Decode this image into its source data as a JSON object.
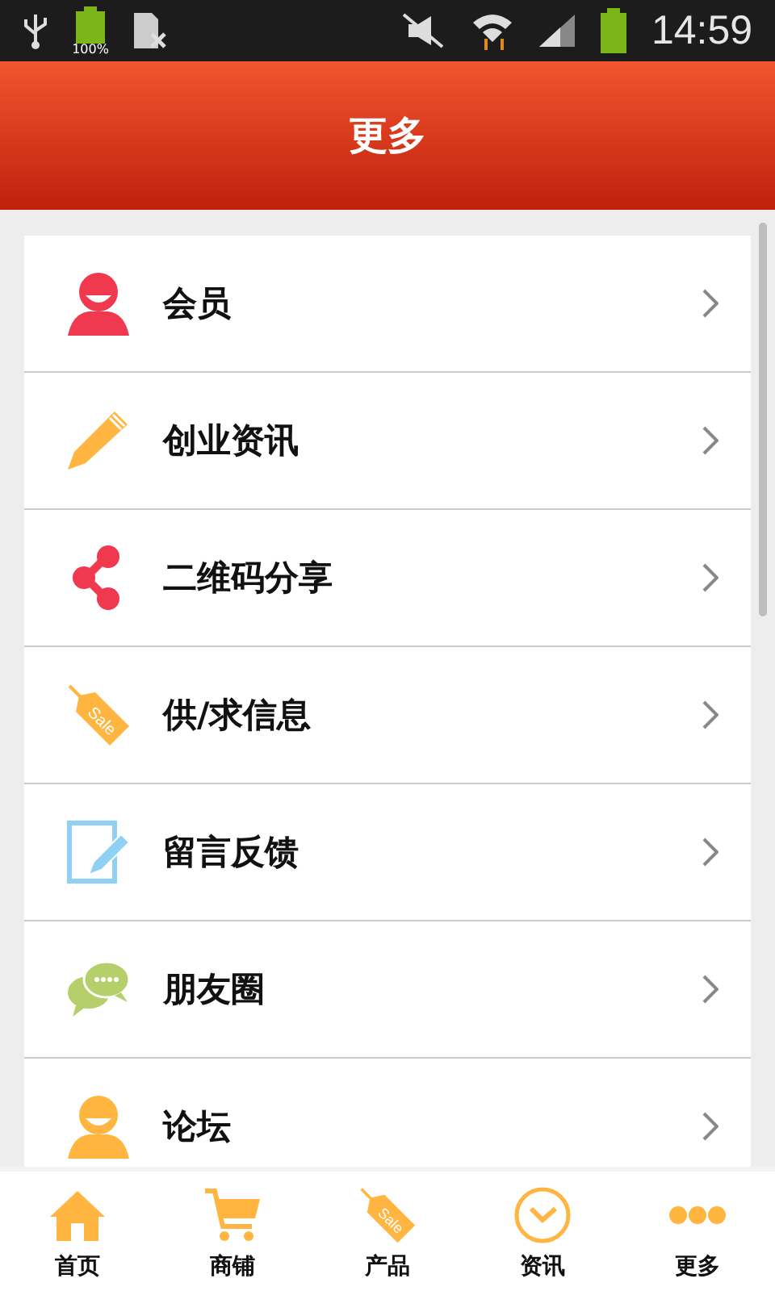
{
  "status_bar": {
    "battery_text": "100%",
    "time": "14:59"
  },
  "header": {
    "title": "更多"
  },
  "menu": [
    {
      "label": "会员",
      "kind": "person",
      "color": "#f0384f"
    },
    {
      "label": "创业资讯",
      "kind": "pencil",
      "color": "#ffb540"
    },
    {
      "label": "二维码分享",
      "kind": "share",
      "color": "#f0384f"
    },
    {
      "label": "供/求信息",
      "kind": "tag",
      "color": "#ffb540",
      "icon_text": "Sale"
    },
    {
      "label": "留言反馈",
      "kind": "note",
      "color": "#8fd0f5"
    },
    {
      "label": "朋友圈",
      "kind": "chat",
      "color": "#b5cf6a"
    },
    {
      "label": "论坛",
      "kind": "person",
      "color": "#ffb540"
    }
  ],
  "tab_bar": [
    {
      "label": "首页",
      "kind": "home"
    },
    {
      "label": "商铺",
      "kind": "cart"
    },
    {
      "label": "产品",
      "kind": "tag",
      "icon_text": "Sale"
    },
    {
      "label": "资讯",
      "kind": "clock"
    },
    {
      "label": "更多",
      "kind": "dots"
    }
  ]
}
